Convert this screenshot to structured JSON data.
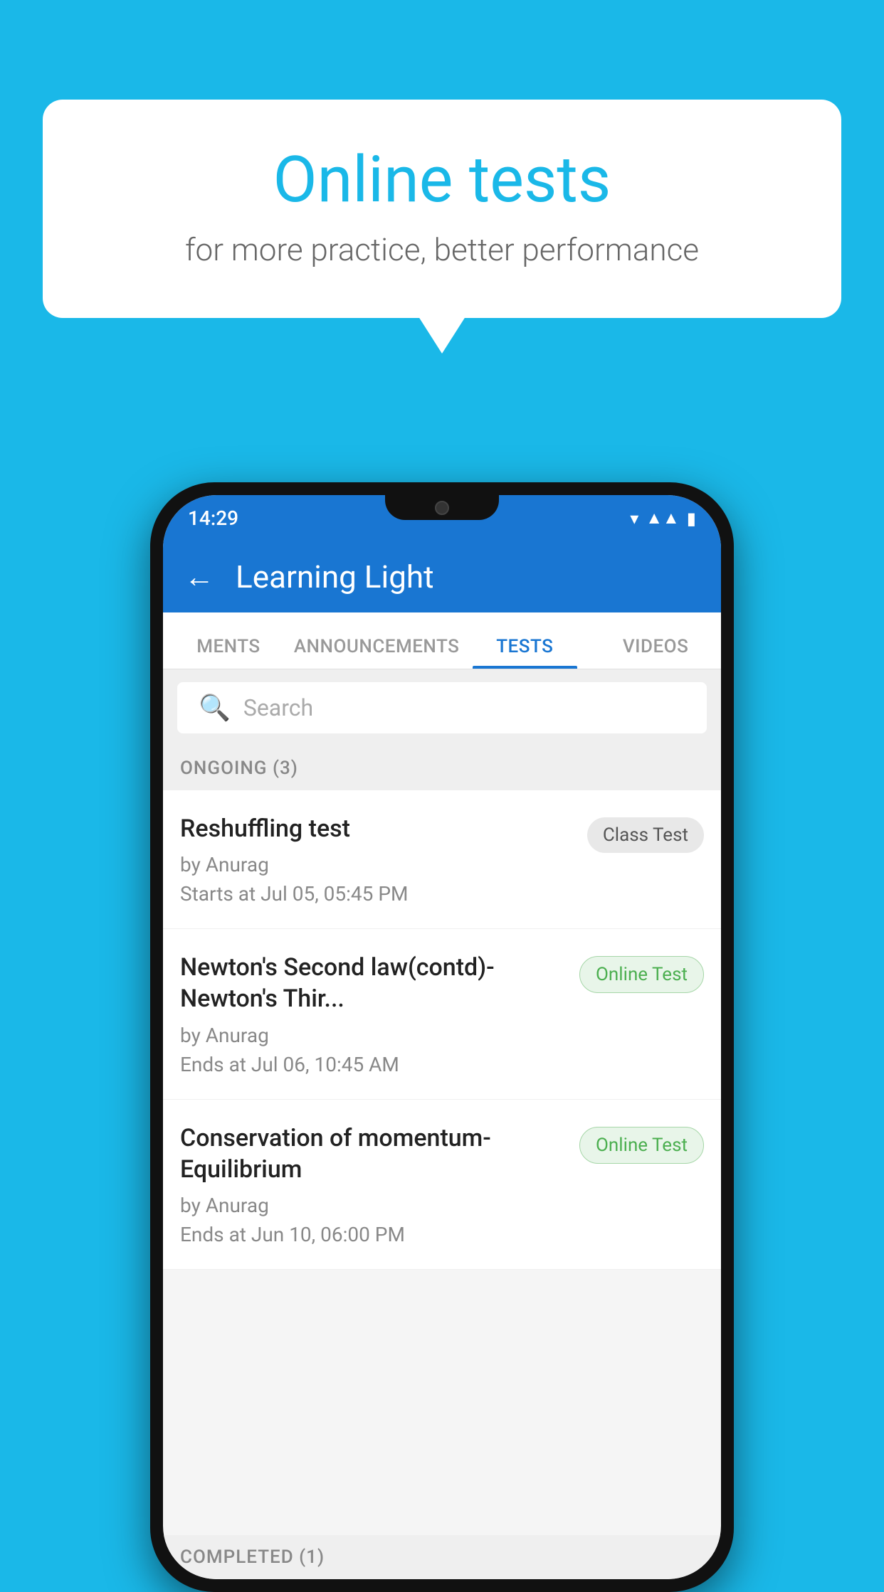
{
  "bubble": {
    "title": "Online tests",
    "subtitle": "for more practice, better performance"
  },
  "status_bar": {
    "time": "14:29"
  },
  "header": {
    "title": "Learning Light",
    "back_label": "←"
  },
  "tabs": [
    {
      "label": "MENTS",
      "active": false
    },
    {
      "label": "ANNOUNCEMENTS",
      "active": false
    },
    {
      "label": "TESTS",
      "active": true
    },
    {
      "label": "VIDEOS",
      "active": false
    }
  ],
  "search": {
    "placeholder": "Search"
  },
  "ongoing": {
    "label": "ONGOING (3)",
    "items": [
      {
        "name": "Reshuffling test",
        "author": "by Anurag",
        "time": "Starts at  Jul 05, 05:45 PM",
        "badge": "Class Test",
        "badge_type": "class"
      },
      {
        "name": "Newton's Second law(contd)-Newton's Thir...",
        "author": "by Anurag",
        "time": "Ends at  Jul 06, 10:45 AM",
        "badge": "Online Test",
        "badge_type": "online"
      },
      {
        "name": "Conservation of momentum-Equilibrium",
        "author": "by Anurag",
        "time": "Ends at  Jun 10, 06:00 PM",
        "badge": "Online Test",
        "badge_type": "online"
      }
    ]
  },
  "completed": {
    "label": "COMPLETED (1)"
  }
}
